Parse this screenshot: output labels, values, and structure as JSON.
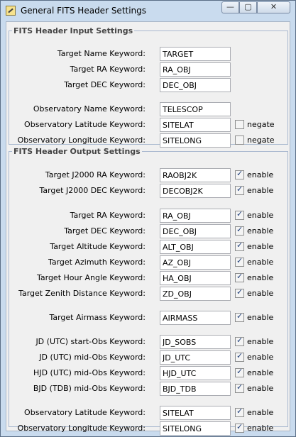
{
  "window": {
    "title": "General FITS Header Settings",
    "minimize_glyph": "—",
    "maximize_glyph": "▢",
    "close_glyph": "✕"
  },
  "input_group": {
    "legend": "FITS Header Input Settings",
    "rows": [
      {
        "label": "Target Name Keyword:",
        "value": "TARGET"
      },
      {
        "label": "Target RA Keyword:",
        "value": "RA_OBJ"
      },
      {
        "label": "Target DEC Keyword:",
        "value": "DEC_OBJ"
      },
      {
        "label": "Observatory Name Keyword:",
        "value": "TELESCOP"
      },
      {
        "label": "Observatory Latitude Keyword:",
        "value": "SITELAT",
        "check_label": "negate",
        "checked": false
      },
      {
        "label": "Observatory Longitude Keyword:",
        "value": "SITELONG",
        "check_label": "negate",
        "checked": false
      }
    ]
  },
  "output_group": {
    "legend": "FITS Header Output Settings",
    "rows": [
      {
        "label": "Target J2000 RA Keyword:",
        "value": "RAOBJ2K",
        "check_label": "enable",
        "checked": true
      },
      {
        "label": "Target J2000 DEC Keyword:",
        "value": "DECOBJ2K",
        "check_label": "enable",
        "checked": true
      },
      {
        "label": "Target RA Keyword:",
        "value": "RA_OBJ",
        "check_label": "enable",
        "checked": true
      },
      {
        "label": "Target DEC Keyword:",
        "value": "DEC_OBJ",
        "check_label": "enable",
        "checked": true
      },
      {
        "label": "Target Altitude Keyword:",
        "value": "ALT_OBJ",
        "check_label": "enable",
        "checked": true
      },
      {
        "label": "Target Azimuth Keyword:",
        "value": "AZ_OBJ",
        "check_label": "enable",
        "checked": true
      },
      {
        "label": "Target Hour Angle Keyword:",
        "value": "HA_OBJ",
        "check_label": "enable",
        "checked": true
      },
      {
        "label": "Target Zenith Distance Keyword:",
        "value": "ZD_OBJ",
        "check_label": "enable",
        "checked": true
      },
      {
        "label": "Target Airmass Keyword:",
        "value": "AIRMASS",
        "check_label": "enable",
        "checked": true
      },
      {
        "label": "JD (UTC) start-Obs Keyword:",
        "value": "JD_SOBS",
        "check_label": "enable",
        "checked": true
      },
      {
        "label": "JD (UTC) mid-Obs Keyword:",
        "value": "JD_UTC",
        "check_label": "enable",
        "checked": true
      },
      {
        "label": "HJD (UTC) mid-Obs Keyword:",
        "value": "HJD_UTC",
        "check_label": "enable",
        "checked": true
      },
      {
        "label": "BJD (TDB) mid-Obs Keyword:",
        "value": "BJD_TDB",
        "check_label": "enable",
        "checked": true
      },
      {
        "label": "Observatory Latitude Keyword:",
        "value": "SITELAT",
        "check_label": "enable",
        "checked": true
      },
      {
        "label": "Observatory Longitude Keyword:",
        "value": "SITELONG",
        "check_label": "enable",
        "checked": true
      }
    ]
  }
}
